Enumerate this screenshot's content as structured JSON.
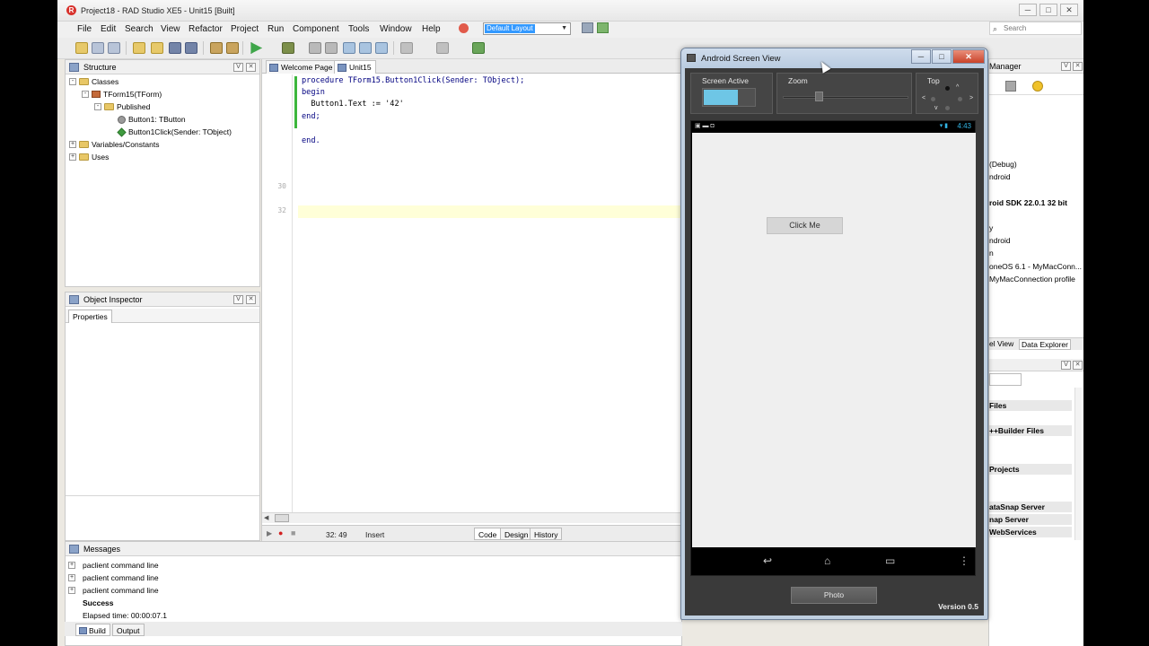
{
  "window": {
    "title": "Project18 - RAD Studio XE5 - Unit15 [Built]",
    "app_icon": "R",
    "controls": {
      "minimize": "─",
      "maximize": "□",
      "close": "✕"
    }
  },
  "menu": {
    "items": [
      "File",
      "Edit",
      "Search",
      "View",
      "Refactor",
      "Project",
      "Run",
      "Component",
      "Tools",
      "Window",
      "Help"
    ],
    "layout_value": "Default Layout",
    "search_placeholder": "Search",
    "dropdown_glyph": "▼",
    "search_glyph": "⌕"
  },
  "structure": {
    "title": "Structure",
    "tree": [
      {
        "label": "Classes",
        "exp": "-"
      },
      {
        "label": "TForm15(TForm)",
        "exp": "-"
      },
      {
        "label": "Published",
        "exp": "-"
      },
      {
        "label": "Button1: TButton",
        "exp": ""
      },
      {
        "label": "Button1Click(Sender: TObject)",
        "exp": ""
      },
      {
        "label": "Variables/Constants",
        "exp": "+"
      },
      {
        "label": "Uses",
        "exp": "+"
      }
    ]
  },
  "object_inspector": {
    "title": "Object Inspector",
    "tab": "Properties"
  },
  "panel_controls": {
    "pin": "ᐯ",
    "close": "✕"
  },
  "editor": {
    "tabs": [
      "Welcome Page",
      "Unit15"
    ],
    "line_numbers": [
      "30",
      "32"
    ],
    "lines": [
      "procedure TForm15.Button1Click(Sender: TObject);",
      "begin",
      "  Button1.Text := '42'",
      "end;",
      "",
      "end."
    ],
    "status": {
      "position": "32: 49",
      "mode": "Insert",
      "play_glyph": "▶",
      "record_glyph": "●",
      "stop_glyph": "■",
      "scroll_glyph": "◀"
    },
    "bottom_tabs": [
      "Code",
      "Design",
      "History"
    ]
  },
  "messages": {
    "title": "Messages",
    "rows": [
      {
        "exp": "+",
        "text": "paclient command line"
      },
      {
        "exp": "+",
        "text": "paclient command line"
      },
      {
        "exp": "+",
        "text": "paclient command line"
      },
      {
        "exp": "",
        "text": "Success"
      },
      {
        "exp": "",
        "text": "Elapsed time: 00:00:07.1"
      }
    ],
    "tabs": [
      "Build",
      "Output"
    ]
  },
  "right_panel": {
    "header": "Manager",
    "lines": [
      "(Debug)",
      "ndroid",
      "roid SDK 22.0.1 32 bit",
      "y",
      "ndroid",
      "n",
      "oneOS 6.1 - MyMacConn...",
      "MyMacConnection profile"
    ],
    "tabs": [
      "el View",
      "Data Explorer"
    ],
    "categories": [
      "Files",
      "++Builder Files",
      "Projects",
      "ataSnap Server",
      "nap Server",
      "WebServices"
    ]
  },
  "android_screen_view": {
    "title": "Android Screen View",
    "screen_active_label": "Screen Active",
    "zoom_label": "Zoom",
    "top_label": "Top",
    "dpad": {
      "up": "^",
      "left": "<",
      "right": ">",
      "down": "v"
    },
    "status_time": "4:43",
    "status_left": "▣ ▬ ◘",
    "status_right": "▾ ▮",
    "button_label": "Click Me",
    "nav_icons": [
      "↩",
      "⌂",
      "▭",
      "⋮"
    ],
    "photo_button": "Photo",
    "version": "Version 0.5",
    "window_controls": {
      "minimize": "─",
      "maximize": "□",
      "close": "✕"
    }
  },
  "colors": {
    "accent": "#3399ff",
    "screen_active": "#6ec6e6",
    "success_green": "#3cb63c"
  }
}
